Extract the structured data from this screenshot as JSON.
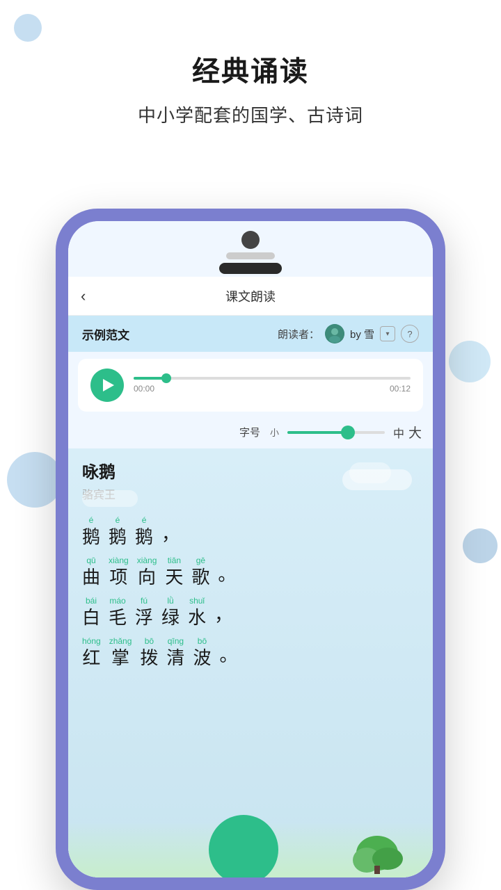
{
  "page": {
    "title": "经典诵读",
    "subtitle": "中小学配套的国学、古诗词"
  },
  "app": {
    "nav": {
      "back_icon": "‹",
      "title": "课文朗读"
    },
    "reading_header": {
      "sample_label": "示例范文",
      "reader_label": "朗读者：",
      "reader_name": "by 雪",
      "dropdown_icon": "▾",
      "help_icon": "?"
    },
    "audio_player": {
      "time_current": "00:00",
      "time_total": "00:12"
    },
    "font_size": {
      "label": "字号",
      "small": "小",
      "medium": "中",
      "large": "大"
    },
    "poem": {
      "title": "咏鹅",
      "author": "骆宾王",
      "lines": [
        {
          "chars": [
            {
              "pinyin": "é",
              "hanzi": "鹅"
            },
            {
              "pinyin": "é",
              "hanzi": "鹅"
            },
            {
              "pinyin": "é",
              "hanzi": "鹅"
            }
          ],
          "punct": "，"
        },
        {
          "chars": [
            {
              "pinyin": "qū",
              "hanzi": "曲"
            },
            {
              "pinyin": "xiàng",
              "hanzi": "项"
            },
            {
              "pinyin": "xiàng",
              "hanzi": "向"
            },
            {
              "pinyin": "tiān",
              "hanzi": "天"
            },
            {
              "pinyin": "gē",
              "hanzi": "歌"
            }
          ],
          "punct": "。"
        },
        {
          "chars": [
            {
              "pinyin": "bái",
              "hanzi": "白"
            },
            {
              "pinyin": "máo",
              "hanzi": "毛"
            },
            {
              "pinyin": "fú",
              "hanzi": "浮"
            },
            {
              "pinyin": "lǜ",
              "hanzi": "绿"
            },
            {
              "pinyin": "shuǐ",
              "hanzi": "水"
            }
          ],
          "punct": "，"
        },
        {
          "chars": [
            {
              "pinyin": "hóng",
              "hanzi": "红"
            },
            {
              "pinyin": "zhǎng",
              "hanzi": "掌"
            },
            {
              "pinyin": "bō",
              "hanzi": "拨"
            },
            {
              "pinyin": "qīng",
              "hanzi": "清"
            },
            {
              "pinyin": "bō",
              "hanzi": "波"
            }
          ],
          "punct": "。"
        }
      ]
    }
  },
  "decorations": {
    "bubble_tl_color": "#a0c8e8",
    "bubble_tr_color": "#b0d8f0",
    "bubble_bl_color": "#a0c8e8",
    "bubble_br_color": "#90b8d8"
  }
}
